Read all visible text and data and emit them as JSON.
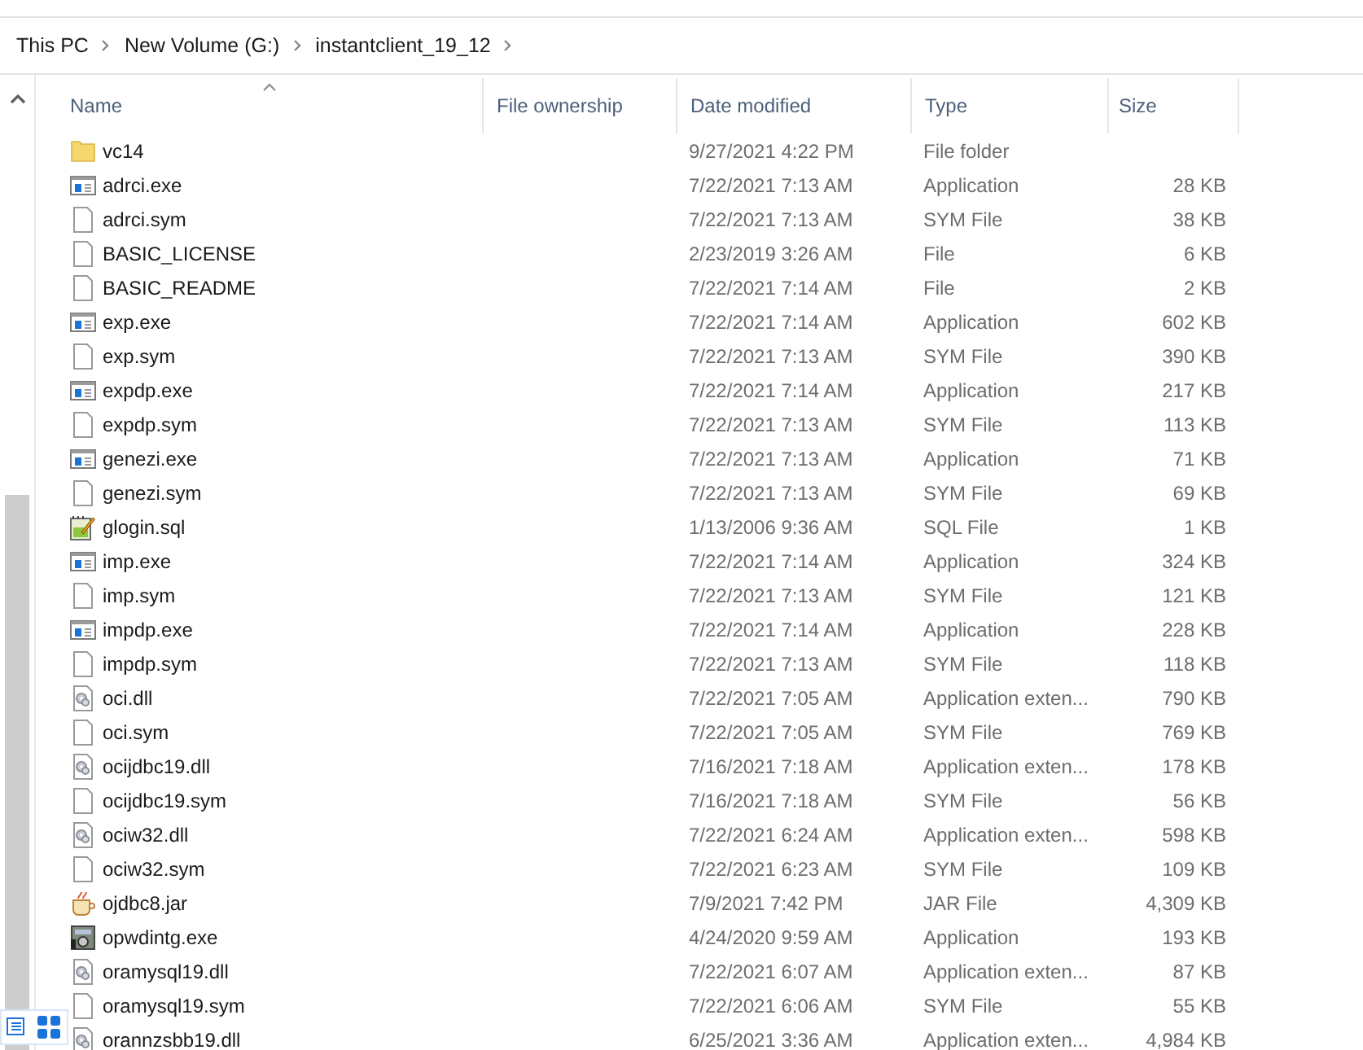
{
  "breadcrumb": [
    "This PC",
    "New Volume (G:)",
    "instantclient_19_12"
  ],
  "columns": [
    "Name",
    "File ownership",
    "Date modified",
    "Type",
    "Size"
  ],
  "files": [
    {
      "kind": "folder",
      "name": "vc14",
      "date": "9/27/2021 4:22 PM",
      "type": "File folder"
    },
    {
      "kind": "exe",
      "name": "adrci.exe",
      "date": "7/22/2021 7:13 AM",
      "type": "Application",
      "size": "28 KB"
    },
    {
      "kind": "file",
      "name": "adrci.sym",
      "date": "7/22/2021 7:13 AM",
      "type": "SYM File",
      "size": "38 KB"
    },
    {
      "kind": "file",
      "name": "BASIC_LICENSE",
      "date": "2/23/2019 3:26 AM",
      "type": "File",
      "size": "6 KB"
    },
    {
      "kind": "file",
      "name": "BASIC_README",
      "date": "7/22/2021 7:14 AM",
      "type": "File",
      "size": "2 KB"
    },
    {
      "kind": "exe",
      "name": "exp.exe",
      "date": "7/22/2021 7:14 AM",
      "type": "Application",
      "size": "602 KB"
    },
    {
      "kind": "file",
      "name": "exp.sym",
      "date": "7/22/2021 7:13 AM",
      "type": "SYM File",
      "size": "390 KB"
    },
    {
      "kind": "exe",
      "name": "expdp.exe",
      "date": "7/22/2021 7:14 AM",
      "type": "Application",
      "size": "217 KB"
    },
    {
      "kind": "file",
      "name": "expdp.sym",
      "date": "7/22/2021 7:13 AM",
      "type": "SYM File",
      "size": "113 KB"
    },
    {
      "kind": "exe",
      "name": "genezi.exe",
      "date": "7/22/2021 7:13 AM",
      "type": "Application",
      "size": "71 KB"
    },
    {
      "kind": "file",
      "name": "genezi.sym",
      "date": "7/22/2021 7:13 AM",
      "type": "SYM File",
      "size": "69 KB"
    },
    {
      "kind": "sql",
      "name": "glogin.sql",
      "date": "1/13/2006 9:36 AM",
      "type": "SQL File",
      "size": "1 KB"
    },
    {
      "kind": "exe",
      "name": "imp.exe",
      "date": "7/22/2021 7:14 AM",
      "type": "Application",
      "size": "324 KB"
    },
    {
      "kind": "file",
      "name": "imp.sym",
      "date": "7/22/2021 7:13 AM",
      "type": "SYM File",
      "size": "121 KB"
    },
    {
      "kind": "exe",
      "name": "impdp.exe",
      "date": "7/22/2021 7:14 AM",
      "type": "Application",
      "size": "228 KB"
    },
    {
      "kind": "file",
      "name": "impdp.sym",
      "date": "7/22/2021 7:13 AM",
      "type": "SYM File",
      "size": "118 KB"
    },
    {
      "kind": "dll",
      "name": "oci.dll",
      "date": "7/22/2021 7:05 AM",
      "type": "Application exten...",
      "size": "790 KB"
    },
    {
      "kind": "file",
      "name": "oci.sym",
      "date": "7/22/2021 7:05 AM",
      "type": "SYM File",
      "size": "769 KB"
    },
    {
      "kind": "dll",
      "name": "ocijdbc19.dll",
      "date": "7/16/2021 7:18 AM",
      "type": "Application exten...",
      "size": "178 KB"
    },
    {
      "kind": "file",
      "name": "ocijdbc19.sym",
      "date": "7/16/2021 7:18 AM",
      "type": "SYM File",
      "size": "56 KB"
    },
    {
      "kind": "dll",
      "name": "ociw32.dll",
      "date": "7/22/2021 6:24 AM",
      "type": "Application exten...",
      "size": "598 KB"
    },
    {
      "kind": "file",
      "name": "ociw32.sym",
      "date": "7/22/2021 6:23 AM",
      "type": "SYM File",
      "size": "109 KB"
    },
    {
      "kind": "jar",
      "name": "ojdbc8.jar",
      "date": "7/9/2021 7:42 PM",
      "type": "JAR File",
      "size": "4,309 KB"
    },
    {
      "kind": "app",
      "name": "opwdintg.exe",
      "date": "4/24/2020 9:59 AM",
      "type": "Application",
      "size": "193 KB"
    },
    {
      "kind": "dll",
      "name": "oramysql19.dll",
      "date": "7/22/2021 6:07 AM",
      "type": "Application exten...",
      "size": "87 KB"
    },
    {
      "kind": "file",
      "name": "oramysql19.sym",
      "date": "7/22/2021 6:06 AM",
      "type": "SYM File",
      "size": "55 KB"
    },
    {
      "kind": "dll",
      "name": "orannzsbb19.dll",
      "date": "6/25/2021 3:36 AM",
      "type": "Application exten...",
      "size": "4,984 KB"
    }
  ]
}
